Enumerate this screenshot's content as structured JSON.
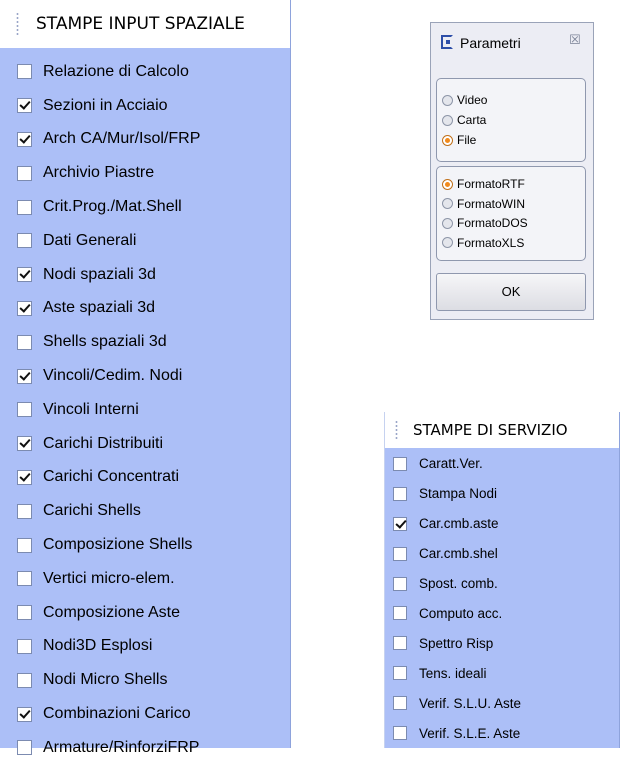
{
  "input_panel": {
    "title": "STAMPE INPUT SPAZIALE",
    "items": [
      {
        "label": "Relazione di Calcolo",
        "checked": false
      },
      {
        "label": "Sezioni in Acciaio",
        "checked": true
      },
      {
        "label": "Arch CA/Mur/Isol/FRP",
        "checked": true
      },
      {
        "label": "Archivio Piastre",
        "checked": false
      },
      {
        "label": "Crit.Prog./Mat.Shell",
        "checked": false
      },
      {
        "label": "Dati Generali",
        "checked": false
      },
      {
        "label": "Nodi spaziali 3d",
        "checked": true
      },
      {
        "label": "Aste spaziali 3d",
        "checked": true
      },
      {
        "label": "Shells spaziali 3d",
        "checked": false
      },
      {
        "label": "Vincoli/Cedim. Nodi",
        "checked": true
      },
      {
        "label": "Vincoli Interni",
        "checked": false
      },
      {
        "label": "Carichi Distribuiti",
        "checked": true
      },
      {
        "label": "Carichi Concentrati",
        "checked": true
      },
      {
        "label": "Carichi Shells",
        "checked": false
      },
      {
        "label": "Composizione Shells",
        "checked": false
      },
      {
        "label": "Vertici micro-elem.",
        "checked": false
      },
      {
        "label": "Composizione Aste",
        "checked": false
      },
      {
        "label": "Nodi3D Esplosi",
        "checked": false
      },
      {
        "label": "Nodi Micro Shells",
        "checked": false
      },
      {
        "label": "Combinazioni Carico",
        "checked": true
      },
      {
        "label": "Armature/RinforziFRP",
        "checked": false
      }
    ]
  },
  "service_panel": {
    "title": "STAMPE DI SERVIZIO",
    "items": [
      {
        "label": "Caratt.Ver.",
        "checked": false
      },
      {
        "label": "Stampa Nodi",
        "checked": false
      },
      {
        "label": "Car.cmb.aste",
        "checked": true
      },
      {
        "label": "Car.cmb.shel",
        "checked": false
      },
      {
        "label": "Spost. comb.",
        "checked": false
      },
      {
        "label": "Computo acc.",
        "checked": false
      },
      {
        "label": "Spettro Risp",
        "checked": false
      },
      {
        "label": "Tens. ideali",
        "checked": false
      },
      {
        "label": "Verif. S.L.U. Aste",
        "checked": false
      },
      {
        "label": "Verif. S.L.E. Aste",
        "checked": false
      }
    ]
  },
  "dialog": {
    "title": "Parametri",
    "close_symbol": "☒",
    "output_options": [
      {
        "label": "Video",
        "selected": false
      },
      {
        "label": "Carta",
        "selected": false
      },
      {
        "label": "File",
        "selected": true
      }
    ],
    "format_options": [
      {
        "label": "FormatoRTF",
        "selected": true
      },
      {
        "label": "FormatoWIN",
        "selected": false
      },
      {
        "label": "FormatoDOS",
        "selected": false
      },
      {
        "label": "FormatoXLS",
        "selected": false
      }
    ],
    "ok_label": "OK"
  },
  "icons": {
    "app_icon": "window-app-icon",
    "close_icon": "close-icon",
    "grip_icon": "grip-handle-icon"
  },
  "colors": {
    "panel_bg": "#acbff7",
    "selected_radio": "#f28a1c"
  }
}
